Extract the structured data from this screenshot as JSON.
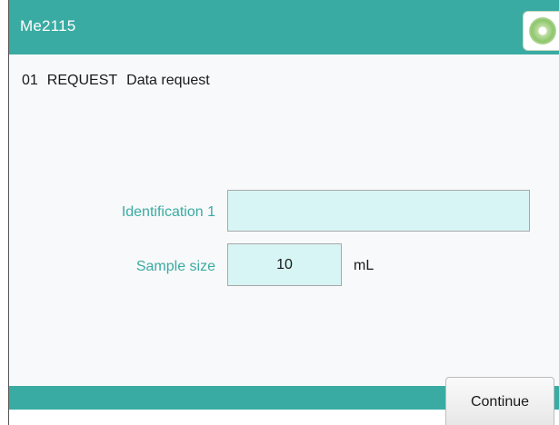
{
  "window": {
    "title": "Me2115",
    "home_icon": "home-disc-icon"
  },
  "header": {
    "number": "01",
    "command": "REQUEST",
    "description": "Data request"
  },
  "form": {
    "identification": {
      "label": "Identification 1",
      "value": ""
    },
    "sample_size": {
      "label": "Sample size",
      "value": "10",
      "unit": "mL"
    }
  },
  "footer": {
    "continue_label": "Continue"
  },
  "colors": {
    "accent": "#3aaba3",
    "input_background": "#d7f5f4",
    "panel_background": "#f8f9fa"
  }
}
